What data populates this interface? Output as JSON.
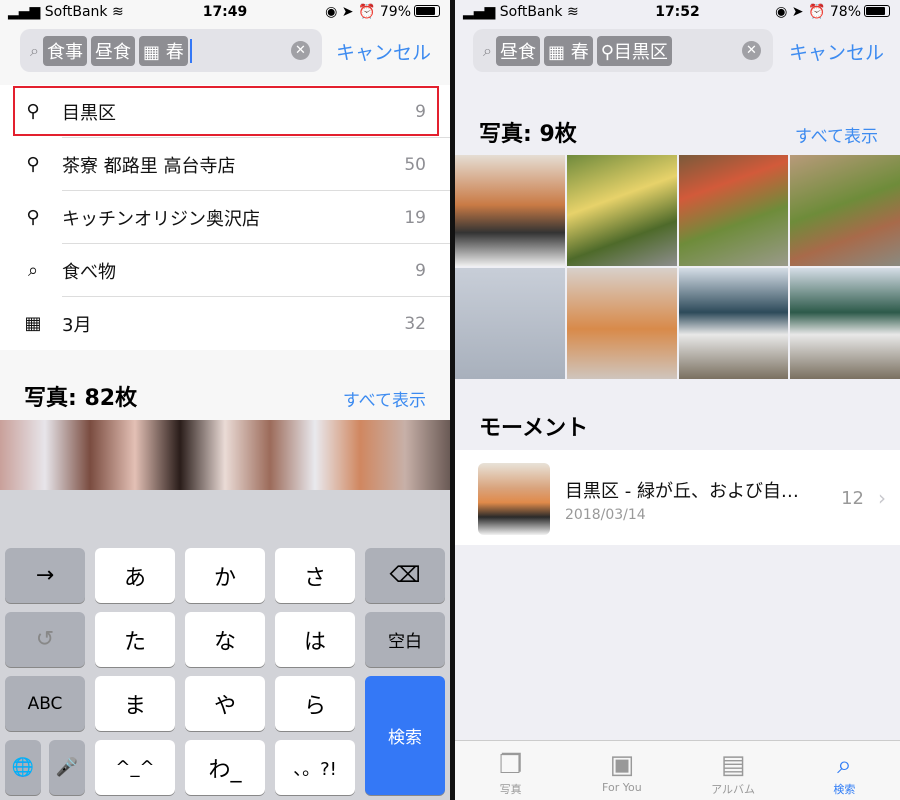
{
  "left": {
    "status": {
      "carrier": "SoftBank",
      "time": "17:49",
      "battery": "79%",
      "battery_level": 0.79
    },
    "search": {
      "tokens": [
        "食事",
        "昼食",
        "春"
      ],
      "token_icons": [
        "",
        "",
        "calendar-icon"
      ]
    },
    "cancel": "キャンセル",
    "suggestions": [
      {
        "icon": "location-pin-icon",
        "label": "目黒区",
        "count": "9",
        "highlighted": true
      },
      {
        "icon": "location-pin-icon",
        "label": "茶寮 都路里 高台寺店",
        "count": "50"
      },
      {
        "icon": "location-pin-icon",
        "label": "キッチンオリジン奥沢店",
        "count": "19"
      },
      {
        "icon": "search-icon",
        "label": "食べ物",
        "count": "9"
      },
      {
        "icon": "calendar-icon",
        "label": "3月",
        "count": "32"
      }
    ],
    "photos_header": "写真: 82枚",
    "show_all": "すべて表示",
    "keyboard": {
      "keys": [
        "→",
        "あ",
        "か",
        "さ",
        "⌫",
        "↺",
        "た",
        "な",
        "は",
        "空白",
        "ABC",
        "ま",
        "や",
        "ら",
        "検索",
        "🌐",
        "🎤",
        "^_^",
        "わ_",
        "、。?!"
      ]
    }
  },
  "right": {
    "status": {
      "carrier": "SoftBank",
      "time": "17:52",
      "battery": "78%",
      "battery_level": 0.78
    },
    "search": {
      "tokens": [
        "昼食",
        "春",
        "目黒区"
      ]
    },
    "cancel": "キャンセル",
    "photos_header": "写真: 9枚",
    "show_all": "すべて表示",
    "moments_header": "モーメント",
    "moment": {
      "title": "目黒区 - 緑が丘、および自…",
      "date": "2018/03/14",
      "count": "12"
    },
    "tabs": [
      {
        "label": "写真"
      },
      {
        "label": "For You"
      },
      {
        "label": "アルバム"
      },
      {
        "label": "検索",
        "active": true
      }
    ],
    "accent": "#3478f6"
  }
}
